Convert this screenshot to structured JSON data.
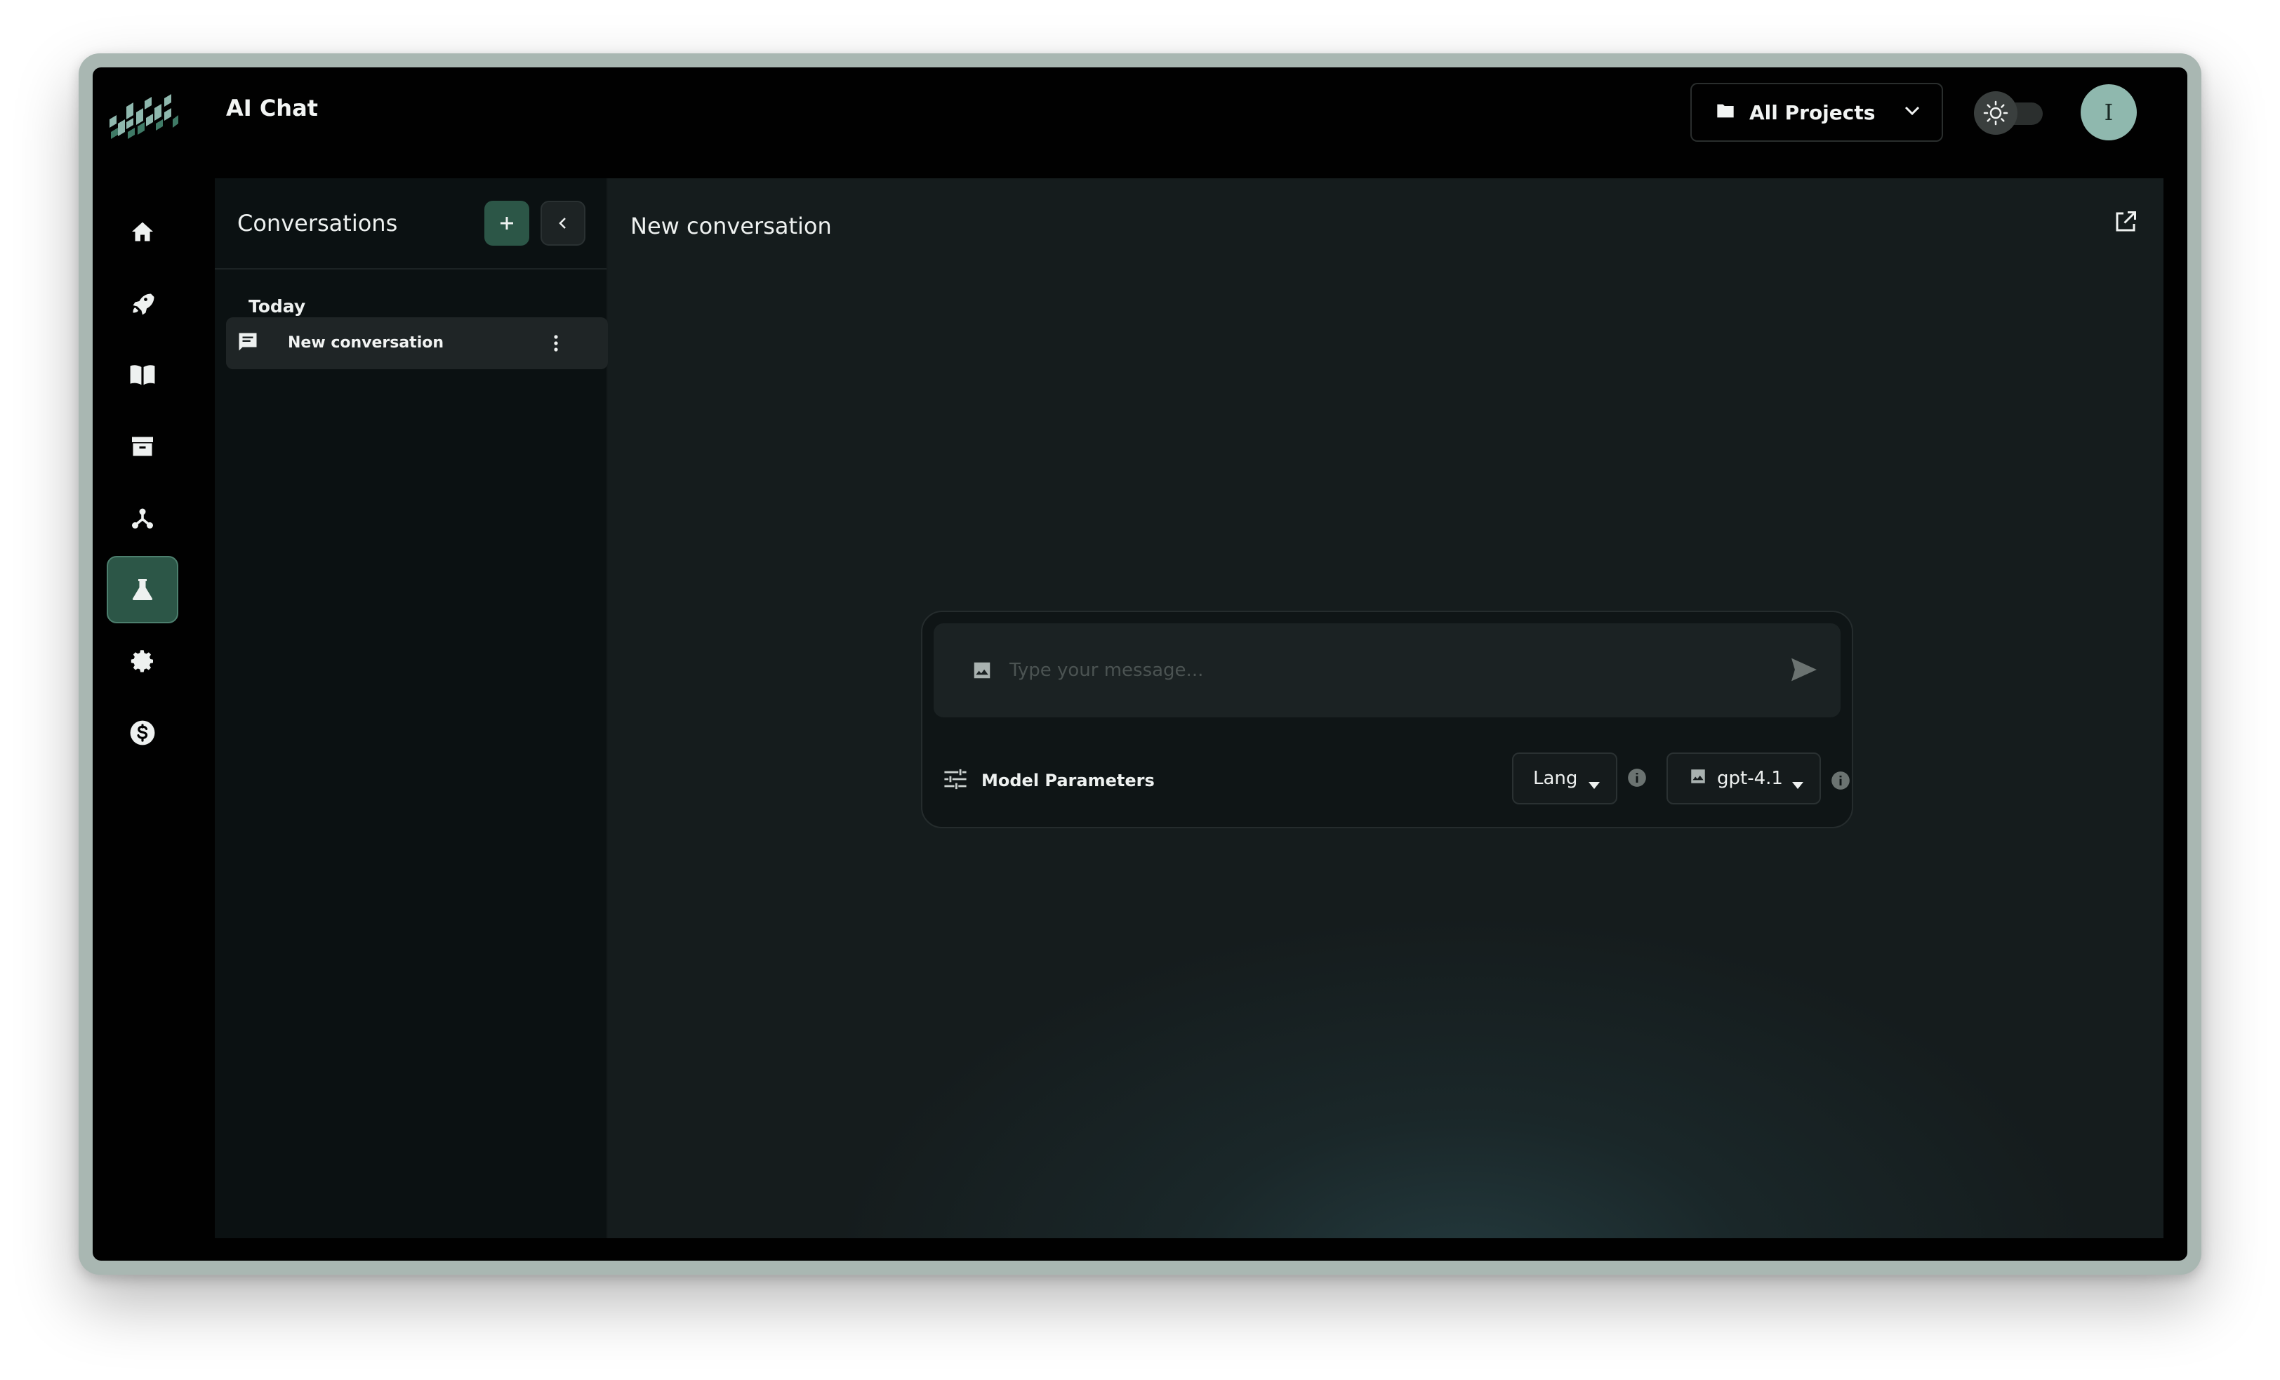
{
  "app": {
    "title": "AI Chat"
  },
  "header": {
    "project_select": {
      "label": "All Projects",
      "icon": "folder-icon"
    },
    "theme_toggle": {
      "icon": "sun-icon",
      "state": "light-off"
    },
    "avatar_initial": "I"
  },
  "nav": {
    "items": [
      {
        "name": "home",
        "icon": "home-icon",
        "active": false
      },
      {
        "name": "launch",
        "icon": "rocket-icon",
        "active": false
      },
      {
        "name": "docs",
        "icon": "book-icon",
        "active": false
      },
      {
        "name": "archive",
        "icon": "archive-icon",
        "active": false
      },
      {
        "name": "integrations",
        "icon": "hub-icon",
        "active": false
      },
      {
        "name": "lab",
        "icon": "flask-icon",
        "active": true
      },
      {
        "name": "settings",
        "icon": "gear-icon",
        "active": false
      },
      {
        "name": "billing",
        "icon": "dollar-icon",
        "active": false
      }
    ]
  },
  "conversations": {
    "title": "Conversations",
    "groups": [
      {
        "label": "Today",
        "items": [
          {
            "label": "New conversation",
            "selected": true
          }
        ]
      }
    ]
  },
  "main": {
    "title": "New conversation",
    "composer": {
      "placeholder": "Type your message...",
      "params_label": "Model Parameters",
      "lang_select": "Lang",
      "model_select": "gpt-4.1"
    }
  },
  "colors": {
    "accent": "#2c5647",
    "panel": "#0b1112",
    "main_bg": "#151c1d",
    "avatar": "#8fb8ae"
  }
}
